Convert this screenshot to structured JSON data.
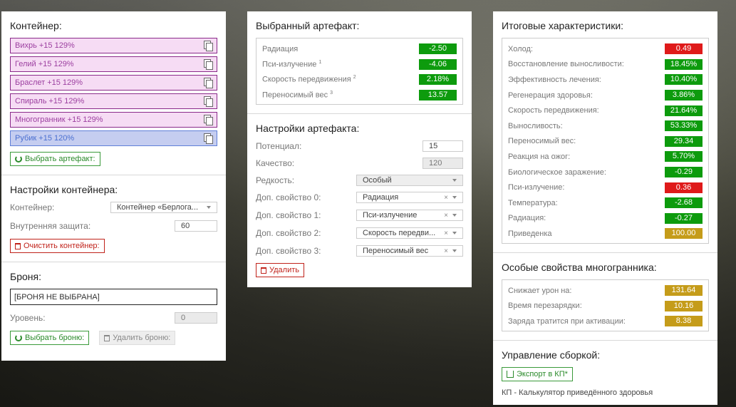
{
  "left": {
    "container_title": "Контейнер:",
    "artifacts": [
      {
        "label": "Вихрь +15 129%"
      },
      {
        "label": "Гелий +15 129%"
      },
      {
        "label": "Браслет +15 129%"
      },
      {
        "label": "Спираль +15 129%"
      },
      {
        "label": "Многогранник +15 129%"
      },
      {
        "label": "Рубик +15 120%"
      }
    ],
    "select_artifact_btn": "Выбрать артефакт:",
    "container_settings_title": "Настройки контейнера:",
    "container_label": "Контейнер:",
    "container_value": "Контейнер «Берлога...",
    "inner_protection_label": "Внутренняя защита:",
    "inner_protection_value": "60",
    "clear_container_btn": "Очистить контейнер:",
    "armor_title": "Броня:",
    "armor_value": "[БРОНЯ НЕ ВЫБРАНА]",
    "level_label": "Уровень:",
    "level_value": "0",
    "select_armor_btn": "Выбрать броню:",
    "delete_armor_btn": "Удалить броню:"
  },
  "mid": {
    "selected_title": "Выбранный артефакт:",
    "stats": [
      {
        "label": "Радиация",
        "sup": "",
        "value": "-2.50",
        "color": "g"
      },
      {
        "label": "Пси-излучение",
        "sup": "1",
        "value": "-4.06",
        "color": "g"
      },
      {
        "label": "Скорость передвижения",
        "sup": "2",
        "value": "2.18%",
        "color": "g"
      },
      {
        "label": "Переносимый вес",
        "sup": "3",
        "value": "13.57",
        "color": "g"
      }
    ],
    "settings_title": "Настройки артефакта:",
    "potential_label": "Потенциал:",
    "potential_value": "15",
    "quality_label": "Качество:",
    "quality_value": "120",
    "rarity_label": "Редкость:",
    "rarity_value": "Особый",
    "extra": [
      {
        "label": "Доп. свойство 0:",
        "value": "Радиация"
      },
      {
        "label": "Доп. свойство 1:",
        "value": "Пси-излучение"
      },
      {
        "label": "Доп. свойство 2:",
        "value": "Скорость передви..."
      },
      {
        "label": "Доп. свойство 3:",
        "value": "Переносимый вес"
      }
    ],
    "delete_btn": "Удалить"
  },
  "right": {
    "total_title": "Итоговые характеристики:",
    "totals": [
      {
        "label": "Холод:",
        "value": "0.49",
        "color": "r"
      },
      {
        "label": "Восстановление выносливости:",
        "value": "18.45%",
        "color": "g"
      },
      {
        "label": "Эффективность лечения:",
        "value": "10.40%",
        "color": "g"
      },
      {
        "label": "Регенерация здоровья:",
        "value": "3.86%",
        "color": "g"
      },
      {
        "label": "Скорость передвижения:",
        "value": "21.64%",
        "color": "g"
      },
      {
        "label": "Выносливость:",
        "value": "53.33%",
        "color": "g"
      },
      {
        "label": "Переносимый вес:",
        "value": "29.34",
        "color": "g"
      },
      {
        "label": "Реакция на ожог:",
        "value": "5.70%",
        "color": "g"
      },
      {
        "label": "Биологическое заражение:",
        "value": "-0.29",
        "color": "g"
      },
      {
        "label": "Пси-излучение:",
        "value": "0.36",
        "color": "r"
      },
      {
        "label": "Температура:",
        "value": "-2.68",
        "color": "g"
      },
      {
        "label": "Радиация:",
        "value": "-0.27",
        "color": "g"
      },
      {
        "label": "Приведенка",
        "value": "100.00",
        "color": "y"
      }
    ],
    "special_title": "Особые свойства многогранника:",
    "special": [
      {
        "label": "Снижает урон на:",
        "value": "131.64",
        "color": "y"
      },
      {
        "label": "Время перезарядки:",
        "value": "10.16",
        "color": "y"
      },
      {
        "label": "Заряда тратится при активации:",
        "value": "8.38",
        "color": "y"
      }
    ],
    "manage_title": "Управление сборкой:",
    "export_btn": "Экспорт в КП*",
    "footnote": "КП - Калькулятор приведённого здоровья"
  }
}
